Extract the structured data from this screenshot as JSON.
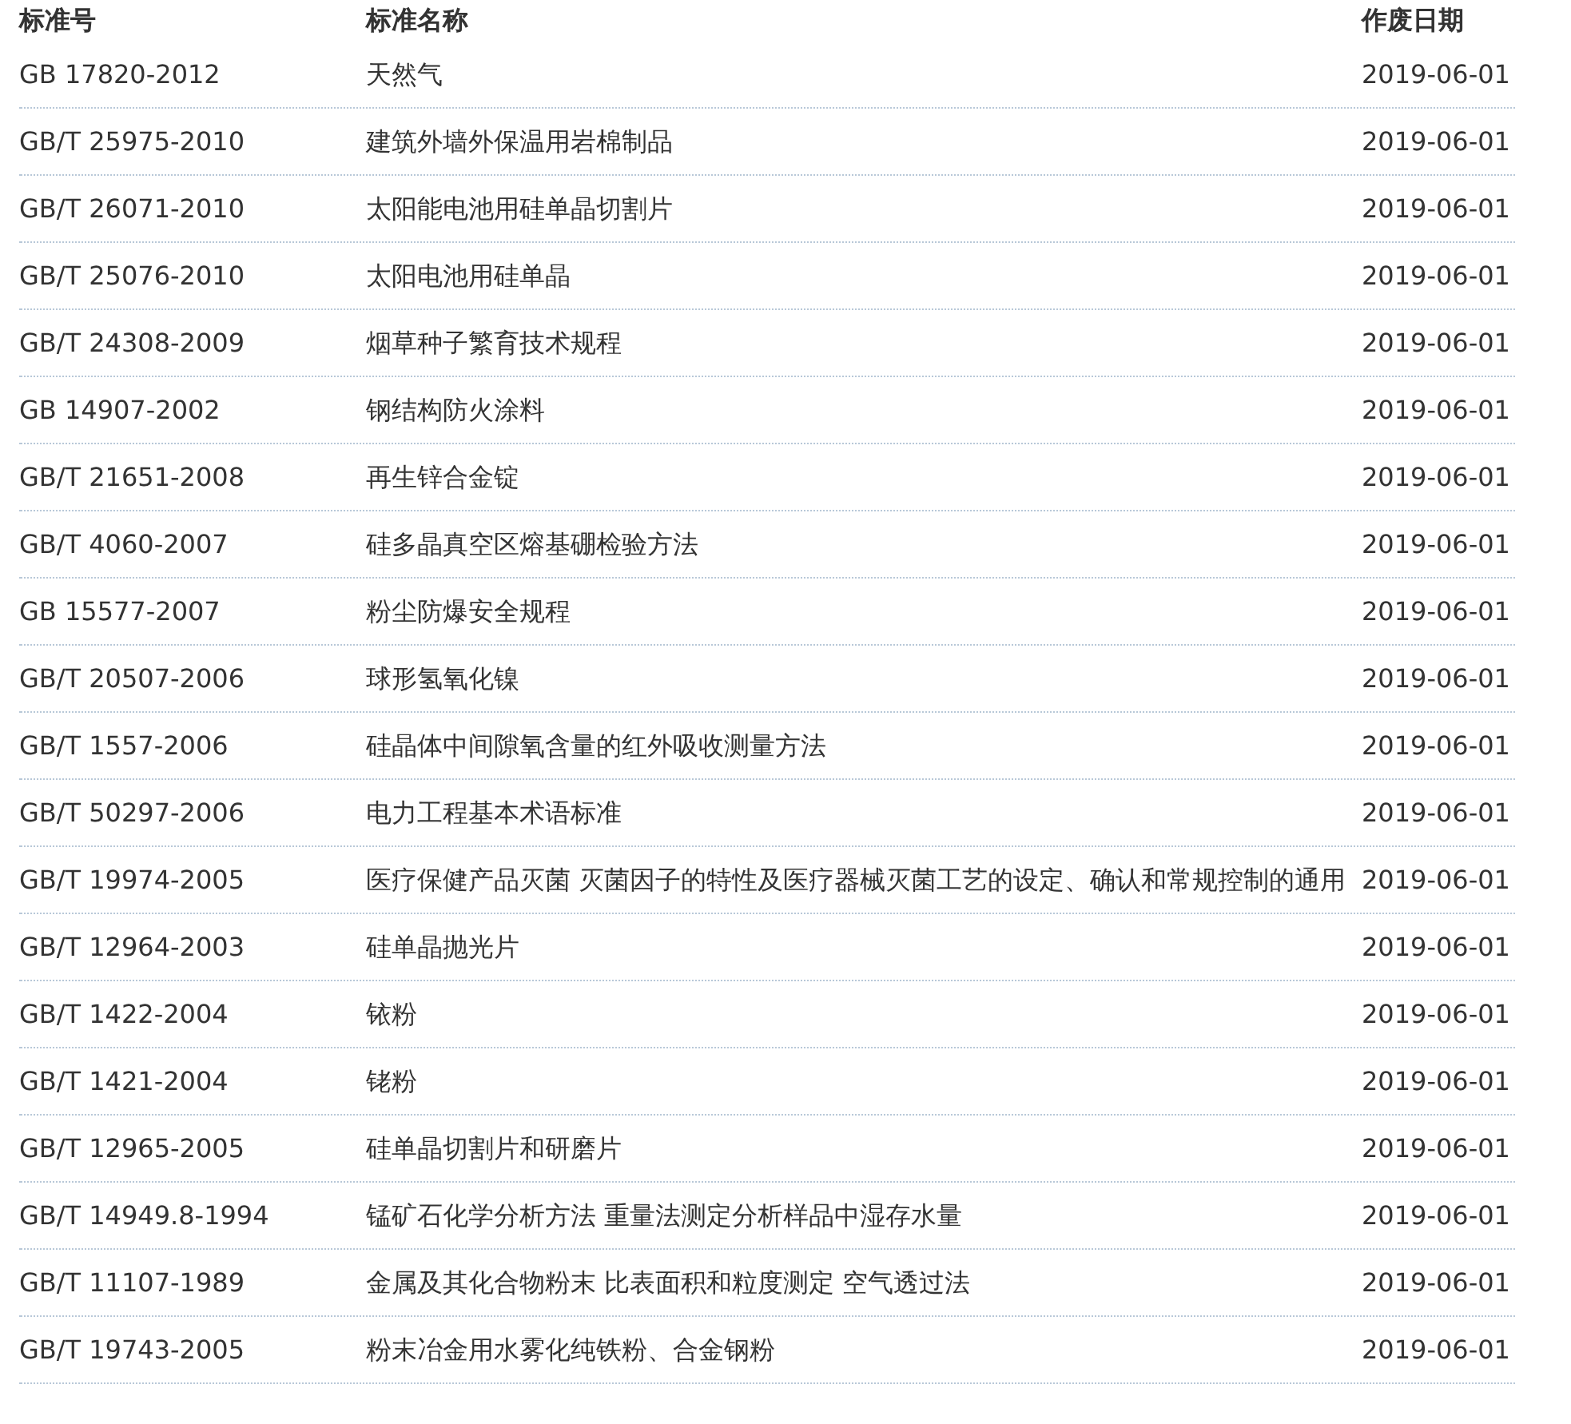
{
  "table": {
    "columns": [
      "标准号",
      "标准名称",
      "作废日期"
    ],
    "rows": [
      [
        "GB 17820-2012",
        "天然气",
        "2019-06-01"
      ],
      [
        "GB/T 25975-2010",
        "建筑外墙外保温用岩棉制品",
        "2019-06-01"
      ],
      [
        "GB/T 26071-2010",
        "太阳能电池用硅单晶切割片",
        "2019-06-01"
      ],
      [
        "GB/T 25076-2010",
        "太阳电池用硅单晶",
        "2019-06-01"
      ],
      [
        "GB/T 24308-2009",
        "烟草种子繁育技术规程",
        "2019-06-01"
      ],
      [
        "GB 14907-2002",
        "钢结构防火涂料",
        "2019-06-01"
      ],
      [
        "GB/T 21651-2008",
        "再生锌合金锭",
        "2019-06-01"
      ],
      [
        "GB/T 4060-2007",
        "硅多晶真空区熔基硼检验方法",
        "2019-06-01"
      ],
      [
        "GB 15577-2007",
        "粉尘防爆安全规程",
        "2019-06-01"
      ],
      [
        "GB/T 20507-2006",
        "球形氢氧化镍",
        "2019-06-01"
      ],
      [
        "GB/T 1557-2006",
        "硅晶体中间隙氧含量的红外吸收测量方法",
        "2019-06-01"
      ],
      [
        "GB/T 50297-2006",
        "电力工程基本术语标准",
        "2019-06-01"
      ],
      [
        "GB/T 19974-2005",
        "医疗保健产品灭菌 灭菌因子的特性及医疗器械灭菌工艺的设定、确认和常规控制的通用",
        "2019-06-01"
      ],
      [
        "GB/T 12964-2003",
        "硅单晶抛光片",
        "2019-06-01"
      ],
      [
        "GB/T 1422-2004",
        "铱粉",
        "2019-06-01"
      ],
      [
        "GB/T 1421-2004",
        "铑粉",
        "2019-06-01"
      ],
      [
        "GB/T 12965-2005",
        "硅单晶切割片和研磨片",
        "2019-06-01"
      ],
      [
        "GB/T 14949.8-1994",
        "锰矿石化学分析方法 重量法测定分析样品中湿存水量",
        "2019-06-01"
      ],
      [
        "GB/T 11107-1989",
        "金属及其化合物粉末 比表面积和粒度测定 空气透过法",
        "2019-06-01"
      ],
      [
        "GB/T 19743-2005",
        "粉末冶金用水雾化纯铁粉、合金钢粉",
        "2019-06-01"
      ]
    ]
  }
}
